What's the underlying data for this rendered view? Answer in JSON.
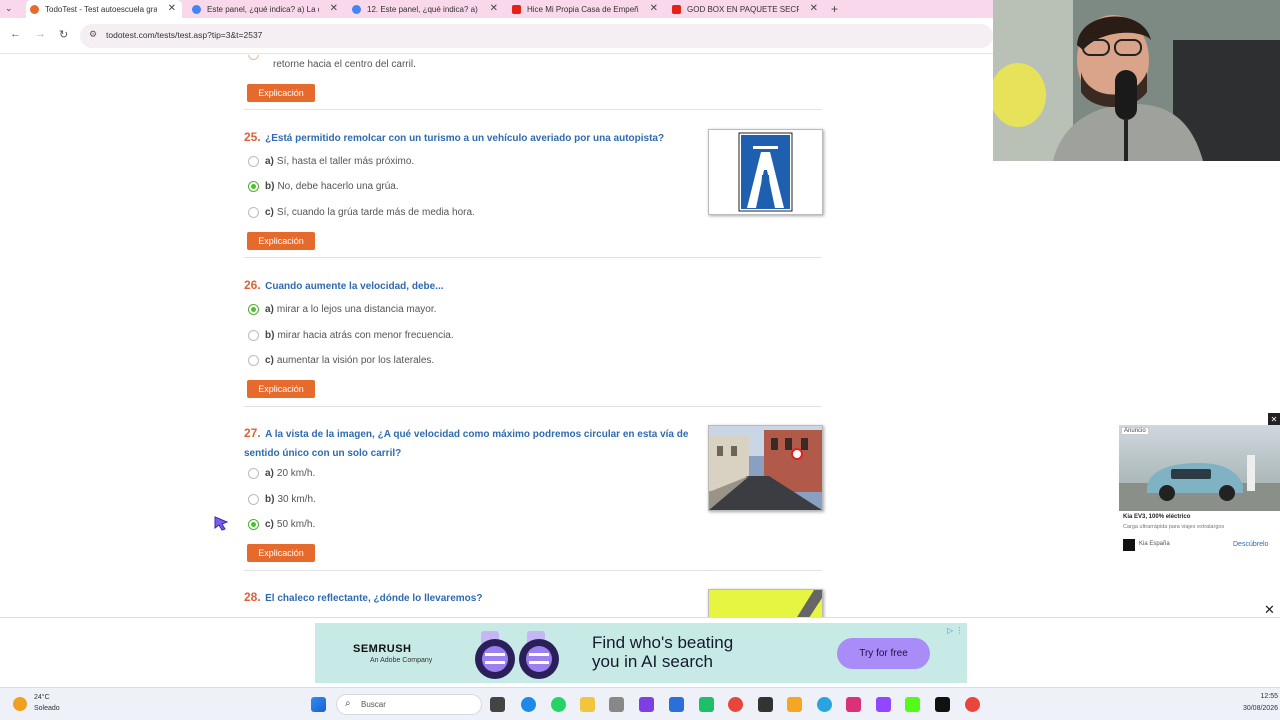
{
  "browser": {
    "tabs": [
      {
        "label": "TodoTest - Test autoescuela gra",
        "icon": "todotest-icon",
        "color": "#e56a2c",
        "active": true
      },
      {
        "label": "Este panel, ¿qué indica? a) La d",
        "icon": "google-icon",
        "color": "#4285f4",
        "active": false
      },
      {
        "label": "12. Este panel, ¿qué indica? a) E",
        "icon": "google-icon",
        "color": "#4285f4",
        "active": false
      },
      {
        "label": "Hice Mi Propia Casa de Empeñ",
        "icon": "youtube-icon",
        "color": "#e62117",
        "active": false
      },
      {
        "label": "GOD BOX EN PAQUETE SECRET",
        "icon": "youtube-icon",
        "color": "#e62117",
        "active": false
      }
    ],
    "new_tab": "+",
    "url": "todotest.com/tests/test.asp?tip=3&t=2537"
  },
  "questions": [
    {
      "prev_tail": "retorne hacia el centro del carril.",
      "explain": "Explicación"
    },
    {
      "number": "25.",
      "text": "¿Está permitido remolcar con un turismo a un vehículo averiado por una autopista?",
      "options": [
        {
          "letter": "a)",
          "text": "Sí, hasta el taller más próximo.",
          "selected": false
        },
        {
          "letter": "b)",
          "text": "No, debe hacerlo una grúa.",
          "selected": true
        },
        {
          "letter": "c)",
          "text": "Sí, cuando la grúa tarde más de media hora.",
          "selected": false
        }
      ],
      "explain": "Explicación",
      "image": "motorway-sign-image"
    },
    {
      "number": "26.",
      "text": "Cuando aumente la velocidad, debe...",
      "options": [
        {
          "letter": "a)",
          "text": "mirar a lo lejos una distancia mayor.",
          "selected": true
        },
        {
          "letter": "b)",
          "text": "mirar hacia atrás con menor frecuencia.",
          "selected": false
        },
        {
          "letter": "c)",
          "text": "aumentar la visión por los laterales.",
          "selected": false
        }
      ],
      "explain": "Explicación"
    },
    {
      "number": "27.",
      "text_line1": "A la vista de la imagen, ¿A qué velocidad como máximo podremos circular en esta vía de",
      "text_line2": "sentido único con un solo carril?",
      "options": [
        {
          "letter": "a)",
          "text": "20 km/h.",
          "selected": false
        },
        {
          "letter": "b)",
          "text": "30 km/h.",
          "selected": false
        },
        {
          "letter": "c)",
          "text": "50 km/h.",
          "selected": true
        }
      ],
      "explain": "Explicación",
      "image": "street-photo-image"
    },
    {
      "number": "28.",
      "text": "El chaleco reflectante, ¿dónde lo llevaremos?",
      "image": "reflective-vest-image"
    }
  ],
  "side_ad": {
    "badge": "Anuncio",
    "title": "Kia EV3, 100% eléctrico",
    "subtitle": "Carga ultrarrápida para viajes extralargos",
    "advertiser": "Kia España",
    "cta": "Descúbrelo"
  },
  "bottom_ad": {
    "brand": "SEMRUSH",
    "brand_sub": "An Adobe Company",
    "headline_1": "Find who's beating",
    "headline_2": "you in AI search",
    "cta": "Try for free"
  },
  "taskbar": {
    "weather_temp": "24°C",
    "weather_desc": "Soleado",
    "search_placeholder": "Buscar",
    "time": "12:55",
    "date": "30/08/2026"
  }
}
